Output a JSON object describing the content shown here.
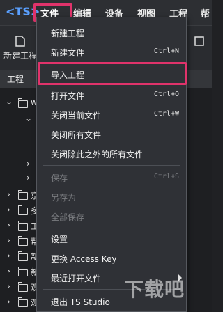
{
  "menubar": {
    "logo": "<TS>",
    "items": [
      {
        "label": "文件"
      },
      {
        "label": "编辑"
      },
      {
        "label": "设备"
      },
      {
        "label": "视图"
      },
      {
        "label": "工程"
      },
      {
        "label": "帮"
      }
    ]
  },
  "toolbar": {
    "new_project_label": "新建工程"
  },
  "panel": {
    "title": "工程"
  },
  "tree": {
    "rows": [
      {
        "label": "w",
        "expanded": true
      },
      {
        "label": "京"
      },
      {
        "label": "多"
      },
      {
        "label": "工"
      },
      {
        "label": "帮"
      },
      {
        "label": "新"
      },
      {
        "label": "新"
      },
      {
        "label": "观"
      },
      {
        "label": "观"
      }
    ]
  },
  "file_menu": {
    "items": [
      {
        "label": "新建工程",
        "shortcut": ""
      },
      {
        "label": "新建文件",
        "shortcut": "Ctrl+N"
      },
      {
        "label": "导入工程",
        "shortcut": ""
      },
      {
        "label": "打开文件",
        "shortcut": "Ctrl+O"
      },
      {
        "label": "关闭当前文件",
        "shortcut": "Ctrl+W"
      },
      {
        "label": "关闭所有文件",
        "shortcut": ""
      },
      {
        "label": "关闭除此之外的所有文件",
        "shortcut": ""
      },
      {
        "label": "保存",
        "shortcut": "Ctrl+S",
        "disabled": true
      },
      {
        "label": "另存为",
        "shortcut": "",
        "disabled": true
      },
      {
        "label": "全部保存",
        "shortcut": "",
        "disabled": true
      },
      {
        "label": "设置",
        "shortcut": ""
      },
      {
        "label": "更换 Access Key",
        "shortcut": ""
      },
      {
        "label": "最近打开文件",
        "shortcut": "",
        "submenu": true
      },
      {
        "label": "退出 TS Studio",
        "shortcut": ""
      }
    ]
  },
  "colors": {
    "highlight": "#e0336b",
    "accent": "#5aa0ff"
  },
  "watermark": "下载吧"
}
